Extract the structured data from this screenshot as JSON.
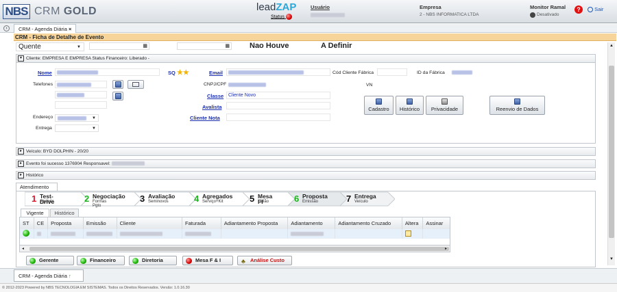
{
  "header": {
    "logo_nbs": "NBS",
    "logo_crm": "CRM",
    "logo_gold": "GOLD",
    "leadzap_prefix": "lead",
    "leadzap_suffix": "ZAP",
    "status_label": "Status",
    "usuario_label": "Usuário",
    "empresa_label": "Empresa",
    "empresa_value": "2 - NBS INFORMATICA LTDA",
    "monitor_label": "Monitor Ramal",
    "monitor_status": "Desativado",
    "help_icon": "help-icon",
    "exit_label": "Sair"
  },
  "tabs": {
    "main_tab": "CRM - Agenda Diária",
    "close": "×"
  },
  "title_bar": "CRM - Ficha de Detalhe de Evento",
  "top_row": {
    "temperature": "Quente",
    "col1": "Nao Houve",
    "col2": "A Definir"
  },
  "cliente_section": "Cliente: EMPRESA E EMPRESA     Status Financeiro: Liberado -",
  "form": {
    "nome": "Nome",
    "telefones": "Telefones",
    "endereco": "Endereço",
    "entrega": "Entrega",
    "email": "Email",
    "cnpj": "CNPJ/CPF",
    "classe": "Classe",
    "classe_value": "Cliente Novo",
    "avalista": "Avalista",
    "cliente_nota": "Cliente Nota",
    "cod_cliente_fabrica": "Cód Cliente Fábrica",
    "id_fabrica": "ID da Fábrica",
    "vn": "VN",
    "sq": "SQ",
    "stars": "★★"
  },
  "action_buttons": [
    "Cadastro",
    "Histórico",
    "Privacidade",
    "Reenvio de Dados"
  ],
  "sections": {
    "veiculo": "Veículo: BYD DOLPHIN - 20/20",
    "evento": "Evento foi sucesso 1376904 Responsavel:",
    "historico": "Histórico"
  },
  "atendimento_tab": "Atendimento",
  "steps": [
    {
      "num": "1",
      "title": "Test-Drive",
      "sub": "Agenda",
      "color": "#e0102a"
    },
    {
      "num": "2",
      "title": "Negociação",
      "sub": "Formas Pgto",
      "color": "#1fb51f"
    },
    {
      "num": "3",
      "title": "Avaliação",
      "sub": "Seminovos",
      "color": "#111111"
    },
    {
      "num": "4",
      "title": "Agregados",
      "sub": "Serviço+Kit",
      "color": "#1fb51f"
    },
    {
      "num": "5",
      "title": "Mesa FI",
      "sub": "Leilão",
      "color": "#111111"
    },
    {
      "num": "6",
      "title": "Proposta",
      "sub": "Emissão",
      "color": "#1fb51f"
    },
    {
      "num": "7",
      "title": "Entrega",
      "sub": "Veículo",
      "color": "#111111"
    }
  ],
  "subtabs": {
    "vigente": "Vigente",
    "historico": "Histórico"
  },
  "table": {
    "headers": [
      "ST",
      "CE",
      "Proposta",
      "Emissão",
      "Cliente",
      "Faturada",
      "Adiantamento Proposta",
      "Adiantamento",
      "Adiantamento Cruzado",
      "Altera",
      "Assinar"
    ]
  },
  "bottom_buttons": [
    {
      "label": "Gerente",
      "icon": "green-dot"
    },
    {
      "label": "Financeiro",
      "icon": "green-dot"
    },
    {
      "label": "Diretoria",
      "icon": "green-dot"
    },
    {
      "label": "Mesa F & I",
      "icon": "red-dot"
    },
    {
      "label": "Análise Custo",
      "icon": "analysis-icon"
    }
  ],
  "taskbar_tab": "CRM - Agenda Diária",
  "footer": "© 2012-2023 Powered by NBS TECNOLOGIA EM SISTEMAS. Todos os Direitos Reservados.   Versão: 1.0.16.30"
}
